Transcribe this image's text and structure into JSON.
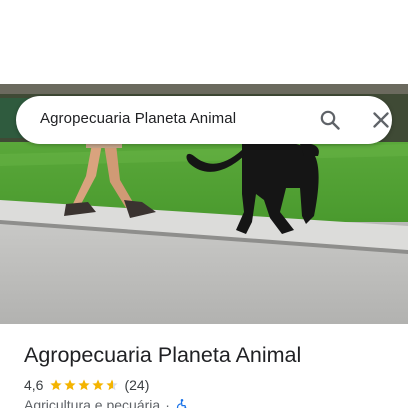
{
  "search": {
    "query": "Agropecuaria Planeta Animal"
  },
  "place": {
    "title": "Agropecuaria Planeta Animal",
    "rating_value": "4,6",
    "rating": 4.6,
    "rating_max": 5,
    "review_count": "(24)",
    "category": "Agricultura e pecuária",
    "separator": "·"
  },
  "icons": {
    "search": "search-icon",
    "close": "close-icon",
    "star": "star-icon",
    "accessibility": "wheelchair-icon"
  },
  "colors": {
    "star": "#f4b400",
    "accessibility": "#1a73e8",
    "title": "#202124",
    "secondary_text": "#5f6368"
  }
}
